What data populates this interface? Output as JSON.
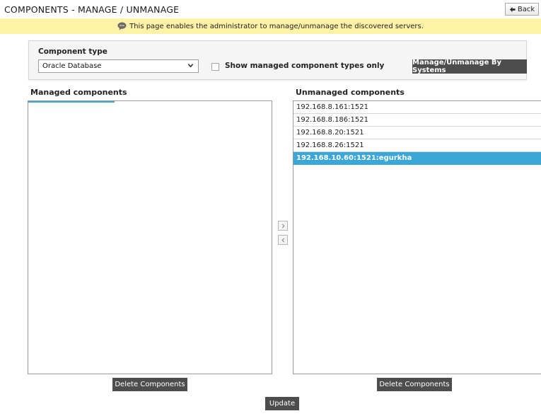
{
  "header": {
    "title": "COMPONENTS - MANAGE / UNMANAGE",
    "back_label": "Back"
  },
  "info": {
    "message": "This page enables the administrator to manage/unmanage the discovered servers."
  },
  "filter": {
    "component_type_label": "Component type",
    "component_type_value": "Oracle Database",
    "show_managed_label": "Show managed component types only",
    "show_managed_checked": false,
    "systems_button_label": "Manage/Unmanage By Systems"
  },
  "managed": {
    "header": "Managed components",
    "items": [],
    "delete_label": "Delete Components"
  },
  "unmanaged": {
    "header": "Unmanaged components",
    "items": [
      "192.168.8.161:1521",
      "192.168.8.186:1521",
      "192.168.8.20:1521",
      "192.168.8.26:1521",
      "192.168.10.60:1521:egurkha"
    ],
    "selected_index": 4,
    "delete_label": "Delete Components"
  },
  "actions": {
    "update_label": "Update"
  },
  "icons": {
    "back": "back-arrow-icon",
    "info": "speech-bubble-icon",
    "select": "chevron-down-icon",
    "move_right": "chevron-right-icon",
    "move_left": "chevron-left-icon"
  },
  "colors": {
    "info_bar": "#fdf2a6",
    "button_dark": "#4d4d4d",
    "selected_row": "#3ba6d8"
  }
}
